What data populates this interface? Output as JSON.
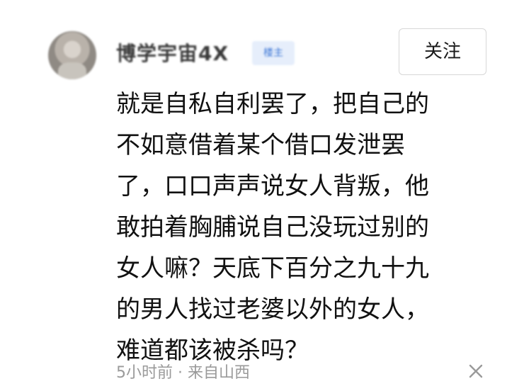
{
  "user": {
    "name": "博学宇宙4X",
    "badge": "楼主"
  },
  "follow_button_label": "关注",
  "comment": {
    "lines": [
      "就是自私自利罢了，把自己的",
      "不如意借着某个借口发泄罢",
      "了，口口声声说女人背叛，他",
      "敢拍着胸脯说自己没玩过别的",
      "女人嘛？天底下百分之九十九",
      "的男人找过老婆以外的女人，",
      "难道都该被杀吗？"
    ]
  },
  "meta": {
    "time": "5小时前",
    "separator": "·",
    "location": "来自山西"
  },
  "colors": {
    "text": "#111111",
    "meta_text": "#9a9a9a",
    "badge_text": "#3d77d6",
    "badge_bg": "#e6eefb",
    "button_border": "#d7d7d7"
  },
  "icons": {
    "close": "close-icon"
  }
}
